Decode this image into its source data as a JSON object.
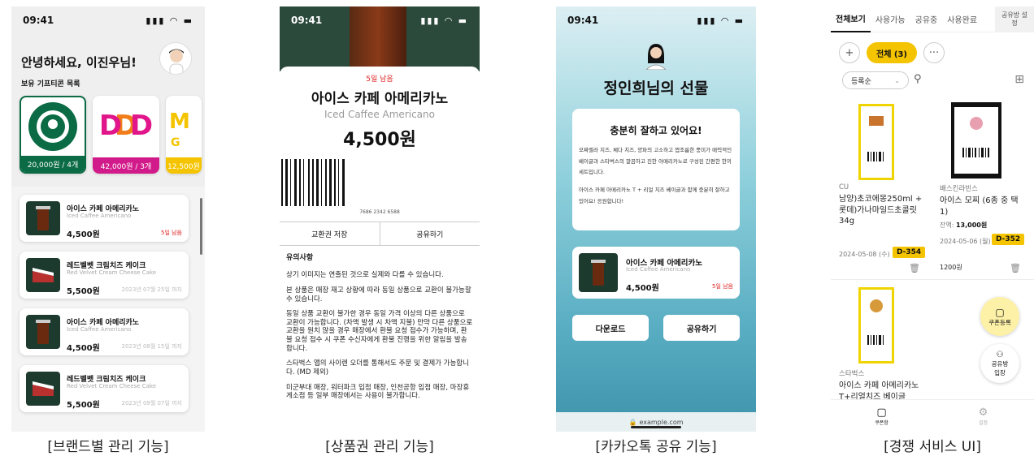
{
  "status_time": "09:41",
  "captions": [
    "[브랜드별 관리 기능]",
    "[상품권 관리 기능]",
    "[카카오톡 공유 기능]",
    "[경쟁 서비스 UI]"
  ],
  "panel1": {
    "greeting": "안녕하세요, 이진우님!",
    "subtitle": "보유 기프티콘 목록",
    "brand_cards": [
      {
        "label": "20,000원 / 4개",
        "color": "#0a6b44"
      },
      {
        "label": "42,000원 / 3개",
        "color": "#d21b8a"
      },
      {
        "label": "12,500원",
        "color": "#f5c400"
      }
    ],
    "gifts": [
      {
        "name": "아이스 카페 아메리카노",
        "en": "Iced Caffee Americano",
        "price": "4,500원",
        "note": "5일 남음"
      },
      {
        "name": "레드벨벳 크림치즈 케이크",
        "en": "Red Velvet Cream Cheese Cake",
        "price": "5,500원",
        "note": "2023년 07월 25일 까지"
      },
      {
        "name": "아이스 카페 아메리카노",
        "en": "Iced Caffee Americano",
        "price": "4,500원",
        "note": "2023년 08월 15일 까지"
      },
      {
        "name": "레드벨벳 크림치즈 케이크",
        "en": "Red Velvet Cream Cheese Cake",
        "price": "5,500원",
        "note": "2023년 09월 07일 까지"
      }
    ]
  },
  "panel2": {
    "days_left": "5일 남음",
    "title": "아이스 카페 아메리카노",
    "title_en": "Iced Caffee Americano",
    "price": "4,500원",
    "barcode_number": "7686 2342 6588",
    "save_button": "교환권 저장",
    "share_button": "공유하기",
    "notes_title": "유의사항",
    "notes": [
      "상기 이미지는 연출된 것으로 실제와 다를 수 있습니다.",
      "본 상품은 매장 재고 상황에 따라 동일 상품으로 교환이 불가능할 수 있습니다.",
      "동일 상품 교환이 불가한 경우 동일 가격 이상의 다른 상품으로 교환이 가능합니다. (차액 발생 시 차액 지불) 만약 다른 상품으로 교환을 원치 않을 경우 매장에서 환불 요청 접수가 가능하며, 환불 요청 접수 시 쿠폰 수신자에게 환불 진행을 위한 알림을 발송합니다.",
      "스타벅스 앱의 사이렌 오더를 통해서도 주문 및 결제가 가능합니다. (MD 제외)",
      "미군부대 매장, 워터파크 입점 매장, 인천공항 입점 매장, 마장휴게소점 등 일부 매장에서는 사용이 불가합니다."
    ]
  },
  "panel3": {
    "gift_title": "정인희님의 선물",
    "message_title": "충분히 잘하고 있어요!",
    "message_p1": "모짜렐라 치즈, 체다 치즈, 양파의 고소하고 짭조름한 풍미가 매력적인 베이글과 스타벅스의 깔끔하고 진한 아메리카노로 구성된 간편한 한끼 세트입니다.",
    "message_p2": "아이스 카페 아메리카노 T + 리얼 치즈 베이글과 함께 충분히 잘하고 있어요! 응원합니다!",
    "product_name": "아이스 카페 아메리카노",
    "product_en": "Iced Caffee Americano",
    "product_price": "4,500원",
    "product_days": "5일 남음",
    "download_button": "다운로드",
    "share_button": "공유하기",
    "url": "example.com"
  },
  "panel4": {
    "tabs": [
      "전체보기",
      "사용가능",
      "공유중",
      "사용완료"
    ],
    "settings_tab": "공유방 설정",
    "filter_pill": "전체 (3)",
    "add_icon": "+",
    "more_icon": "···",
    "sort_label": "등록순",
    "items": [
      {
        "brand": "CU",
        "name": "남양)초코에몽250ml + 롯데)가나마일드초콜릿34g",
        "date": "2024-05-08 (수)",
        "dday": "D-354"
      },
      {
        "brand": "배스킨라빈스",
        "name": "아이스 모찌 (6종 중 택 1)",
        "balance_label": "잔액: ",
        "balance": "13,000원",
        "date": "2024-05-06 (월)",
        "dday": "D-352",
        "price": "1200원"
      },
      {
        "brand": "스타벅스",
        "name": "아이스 카페 아메리카노 T+리얼치즈 베이글"
      }
    ],
    "fab_coupon": "쿠폰등록",
    "fab_share_l1": "공유방",
    "fab_share_l2": "입장",
    "nav_coupon": "쿠폰함",
    "nav_settings": "설정"
  }
}
